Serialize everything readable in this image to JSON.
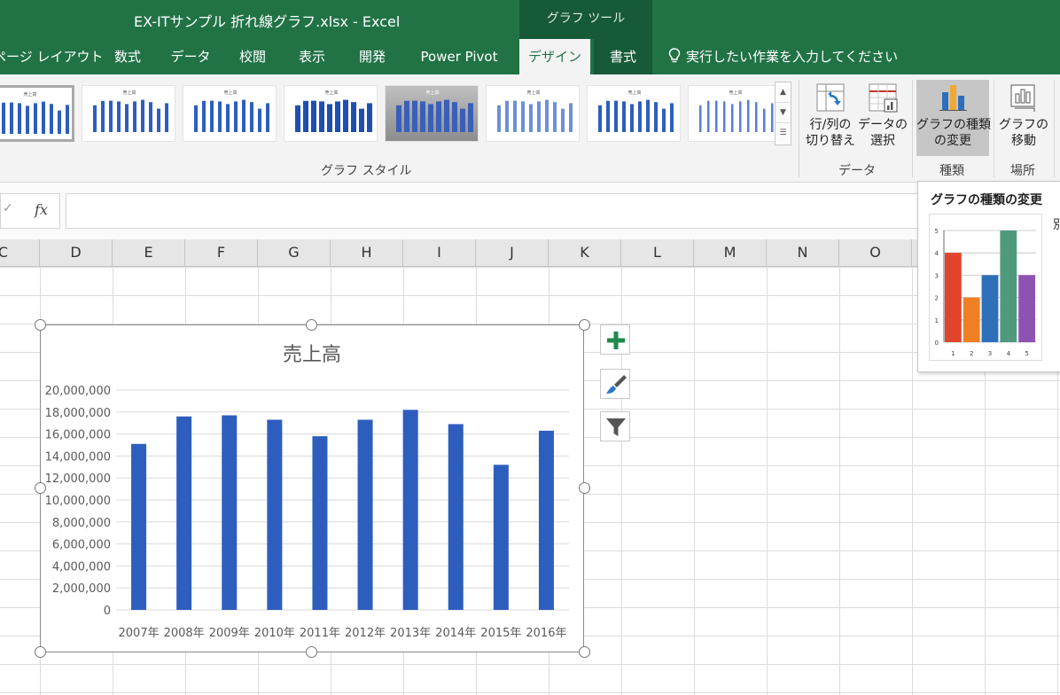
{
  "window": {
    "title": "EX-ITサンプル  折れ線グラフ.xlsx  -  Excel",
    "context_tab_group": "グラフ ツール"
  },
  "tabs": [
    {
      "label": "ページ レイアウト"
    },
    {
      "label": "数式"
    },
    {
      "label": "データ"
    },
    {
      "label": "校閲"
    },
    {
      "label": "表示"
    },
    {
      "label": "開発"
    },
    {
      "label": "Power Pivot"
    },
    {
      "label": "デザイン",
      "active": true
    },
    {
      "label": "書式"
    }
  ],
  "tell_me": {
    "placeholder": "実行したい作業を入力してください",
    "icon": "lightbulb-icon"
  },
  "ribbon": {
    "gallery": {
      "thumbnail_title": "売上高",
      "thumbnail_count": 8,
      "selected_index": 0,
      "group_label": "グラフ スタイル"
    },
    "switch_row_column": {
      "label": "行/列の\n切り替え",
      "icon": "switch-row-column-icon"
    },
    "select_data": {
      "label": "データの\n選択",
      "icon": "select-data-icon"
    },
    "data_group_label": "データ",
    "change_chart_type": {
      "label": "グラフの種類\nの変更",
      "icon": "change-chart-type-icon"
    },
    "type_group_label": "種類",
    "move_chart": {
      "label": "グラフの\n移動",
      "icon": "move-chart-icon"
    },
    "location_group_label": "場所",
    "colors": {
      "brand_green": "#217346",
      "context_green": "#175a37",
      "bar_blue": "#2e5ebd"
    }
  },
  "formula_bar": {
    "check_symbol": "✓",
    "fx_label": "fx",
    "value": ""
  },
  "columns": [
    "C",
    "D",
    "E",
    "F",
    "G",
    "H",
    "I",
    "J",
    "K",
    "L",
    "M",
    "N",
    "O"
  ],
  "chart_side_buttons": [
    {
      "name": "chart-elements-button",
      "icon": "plus-icon"
    },
    {
      "name": "chart-styles-button",
      "icon": "brush-icon"
    },
    {
      "name": "chart-filters-button",
      "icon": "funnel-icon"
    }
  ],
  "chart_data": {
    "type": "bar",
    "title": "売上高",
    "categories": [
      "2007年",
      "2008年",
      "2009年",
      "2010年",
      "2011年",
      "2012年",
      "2013年",
      "2014年",
      "2015年",
      "2016年"
    ],
    "values": [
      15100000,
      17600000,
      17700000,
      17300000,
      15800000,
      17300000,
      18200000,
      16900000,
      13200000,
      16300000
    ],
    "ylim": [
      0,
      20000000
    ],
    "yticks": [
      0,
      2000000,
      4000000,
      6000000,
      8000000,
      10000000,
      12000000,
      14000000,
      16000000,
      18000000,
      20000000
    ],
    "ytick_labels": [
      "0",
      "2,000,000",
      "4,000,000",
      "6,000,000",
      "8,000,000",
      "10,000,000",
      "12,000,000",
      "14,000,000",
      "16,000,000",
      "18,000,000",
      "20,000,000"
    ],
    "grid": true,
    "color": "#2e5ebd"
  },
  "tooltip": {
    "title": "グラフの種類の変更",
    "extra_text": "別",
    "preview_chart": {
      "type": "bar",
      "categories": [
        "1",
        "2",
        "3",
        "4",
        "5"
      ],
      "values": [
        4,
        2,
        3,
        5,
        3
      ],
      "ylim": [
        0,
        5
      ],
      "yticks": [
        "0",
        "1",
        "2",
        "3",
        "4",
        "5"
      ],
      "colors": [
        "#e0452b",
        "#f07e22",
        "#2f6fba",
        "#4f9a7c",
        "#8e52b3"
      ]
    }
  }
}
